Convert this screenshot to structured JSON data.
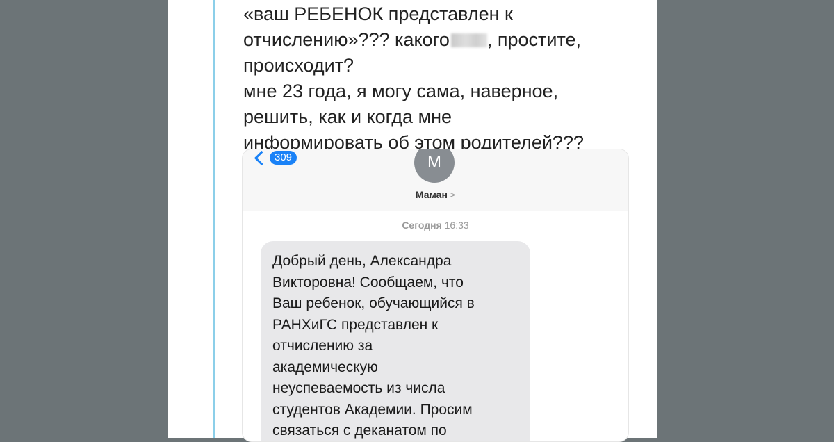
{
  "tweet": {
    "line1": "«ваш РЕБЕНОК представлен к",
    "line2_a": "отчислению»??? какого",
    "line2_b": ", простите,",
    "line3": "происходит?",
    "line4": "мне 23 года, я могу сама, наверное,",
    "line5": "решить, как и когда мне",
    "line6": "информировать об этом родителей???"
  },
  "messages": {
    "back_badge": "309",
    "avatar_initial": "М",
    "contact_name": "Маман",
    "contact_chevron": ">",
    "date_label": "Сегодня",
    "time_label": "16:33",
    "sms_lines": [
      "Добрый день, Александра",
      "Викторовна! Сообщаем, что",
      "Ваш ребенок, обучающийся в",
      "РАНХиГС представлен к",
      "отчислению за",
      "академическую",
      "неуспеваемость из числа",
      "студентов Академии. Просим",
      "связаться с деканатом по"
    ]
  },
  "colors": {
    "background": "#6c7477",
    "accent_blue": "#1a82f7",
    "thread_line": "#8ccfe9",
    "bubble": "#e8e8ea"
  },
  "icons": {
    "back": "chevron-left-icon",
    "contact_more": "chevron-right-icon"
  }
}
